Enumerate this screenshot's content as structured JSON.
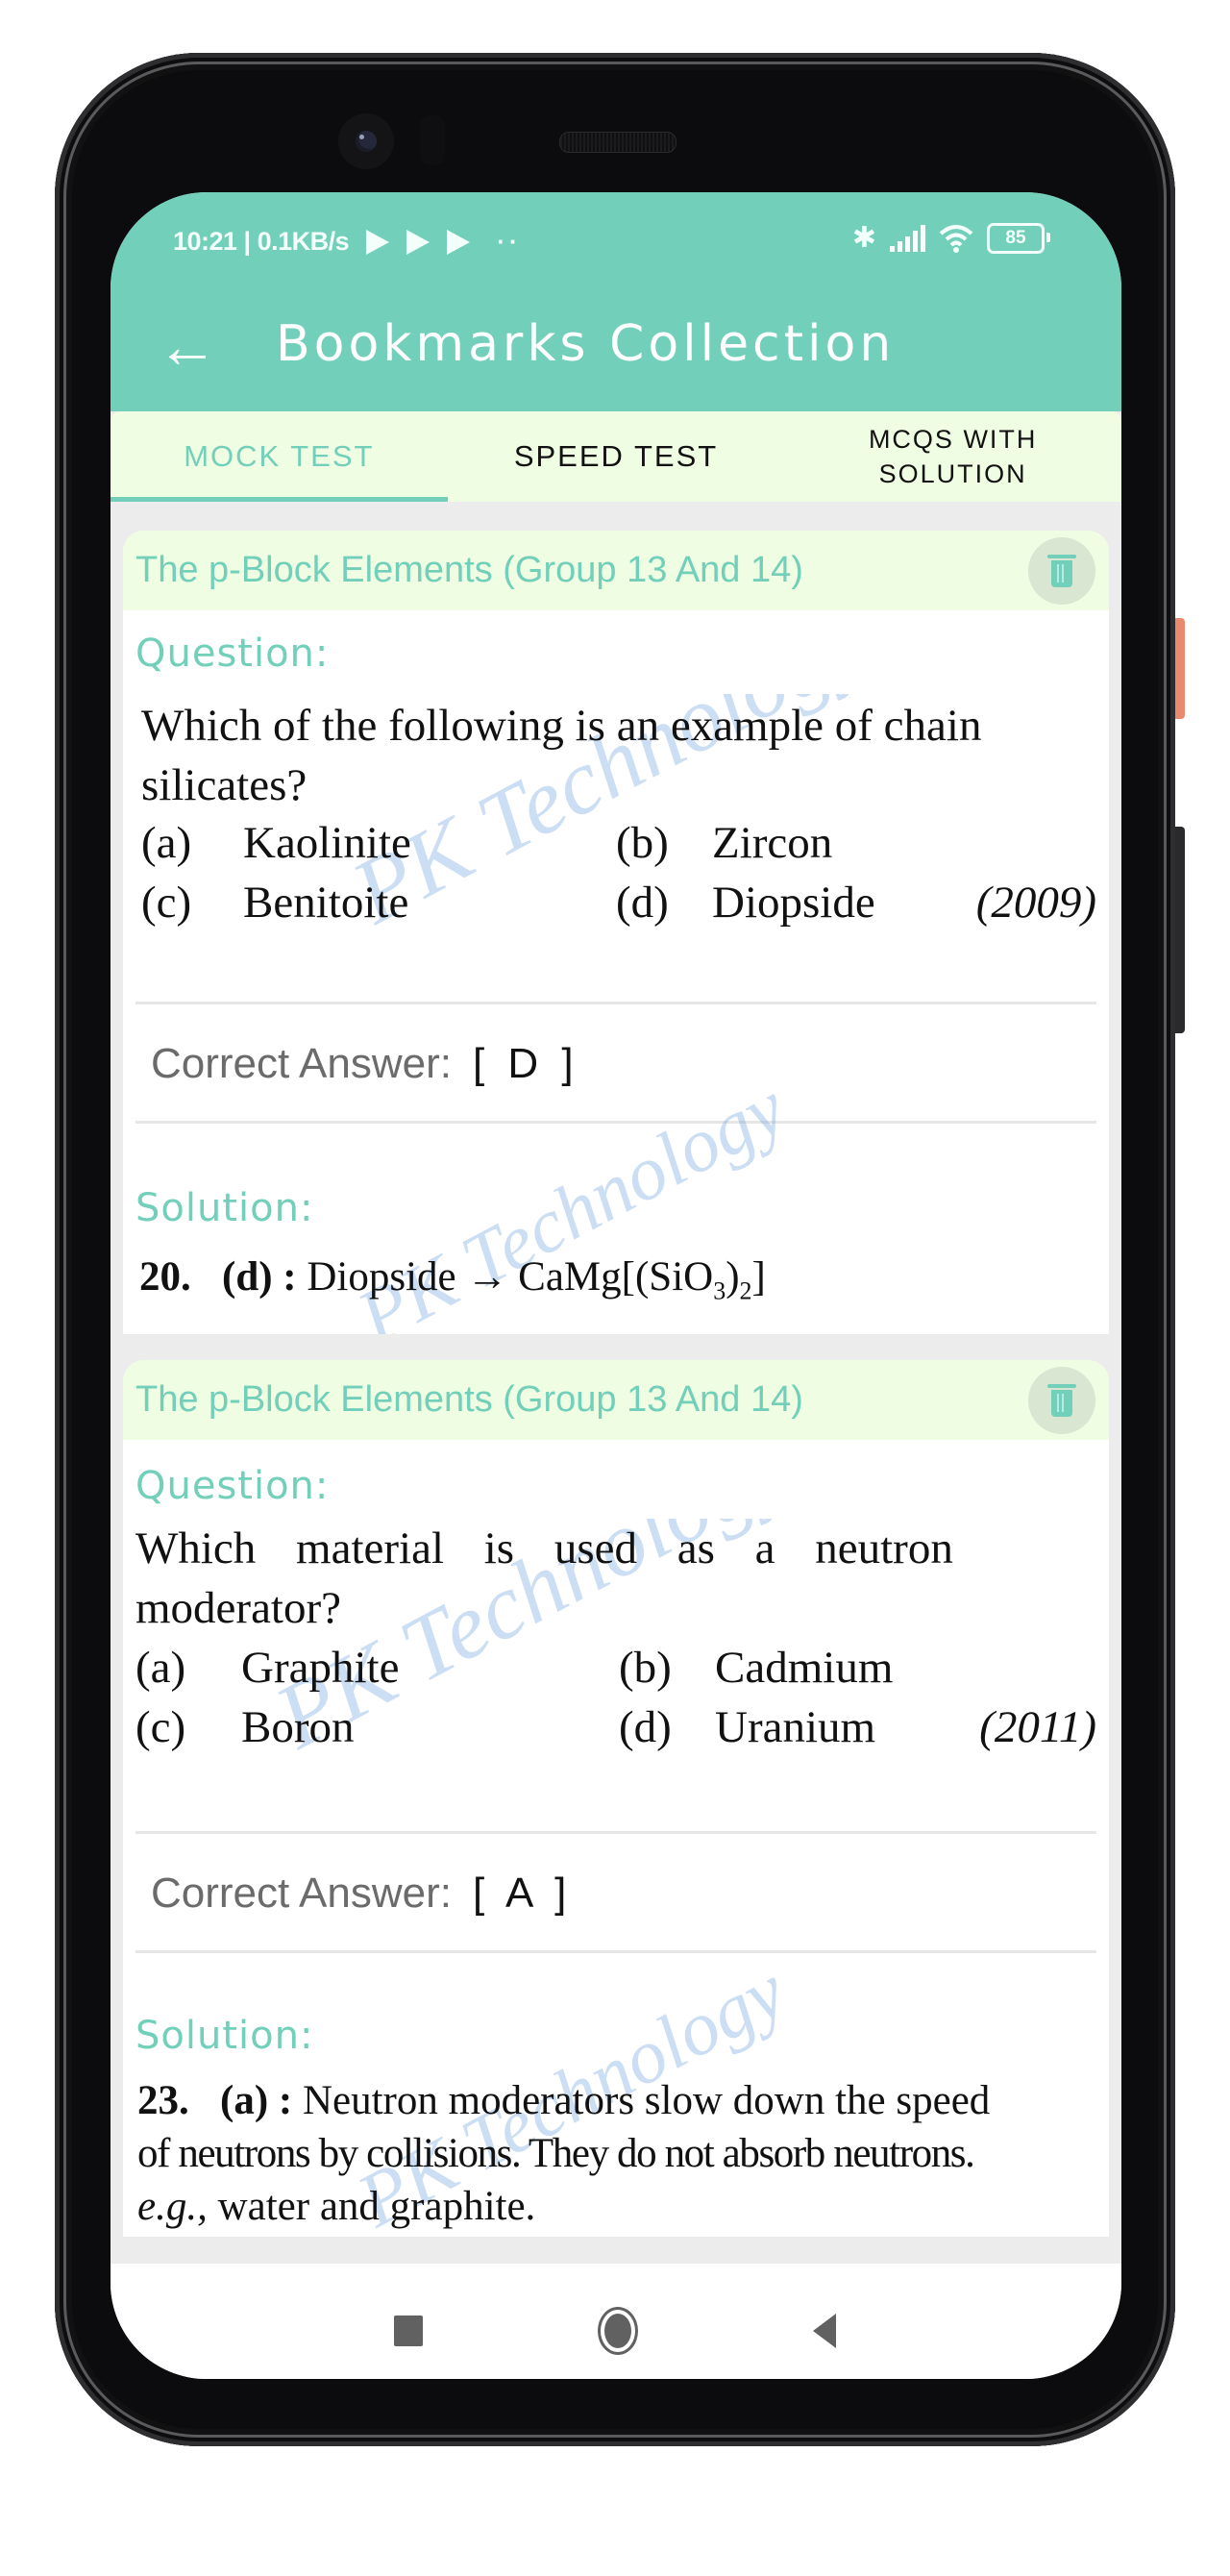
{
  "status_bar": {
    "time_speed": "10:21 | 0.1KB/s",
    "notification_icons": [
      "play-store-icon",
      "play-store-icon",
      "play-store-icon"
    ],
    "more_dots": "··",
    "bluetooth_icon": "bluetooth-icon",
    "signal_icon": "signal-icon",
    "wifi_icon": "wifi-icon",
    "battery_level": "85"
  },
  "header": {
    "back_icon": "←",
    "title": "Bookmarks Collection"
  },
  "tabs": [
    {
      "label": "MOCK TEST",
      "active": true
    },
    {
      "label": "SPEED TEST",
      "active": false
    },
    {
      "label_line1": "MCQS WITH",
      "label_line2": "SOLUTION",
      "active": false
    }
  ],
  "colors": {
    "accent": "#72cfba",
    "header_bg": "#72cfba",
    "tab_bg": "#effde2",
    "card_header_bg": "#effde2",
    "list_bg": "#ececec"
  },
  "labels": {
    "question": "Question:",
    "correct_answer": "Correct Answer:",
    "solution": "Solution:"
  },
  "bookmarks": [
    {
      "chapter": "The p-Block Elements (Group 13 And 14)",
      "question_lines": [
        "Which of the following is an example of chain",
        "silicates?"
      ],
      "options": [
        {
          "key": "(a)",
          "text": "Kaolinite"
        },
        {
          "key": "(b)",
          "text": "Zircon"
        },
        {
          "key": "(c)",
          "text": "Benitoite"
        },
        {
          "key": "(d)",
          "text": "Diopside"
        }
      ],
      "year": "(2009)",
      "correct_answer": "[ D ]",
      "solution": {
        "number": "20.",
        "key": "(d) :",
        "text": "Diopside → CaMg[(SiO",
        "sub1": "3",
        "mid": ")",
        "sub2": "2",
        "end": "]"
      },
      "watermark": "PK Technology"
    },
    {
      "chapter": "The p-Block Elements (Group 13 And 14)",
      "question_lines": [
        "Which material is used as a neutron",
        "moderator?"
      ],
      "options": [
        {
          "key": "(a)",
          "text": "Graphite"
        },
        {
          "key": "(b)",
          "text": "Cadmium"
        },
        {
          "key": "(c)",
          "text": "Boron"
        },
        {
          "key": "(d)",
          "text": "Uranium"
        }
      ],
      "year": "(2011)",
      "correct_answer": "[ A ]",
      "solution": {
        "number": "23.",
        "key": "(a) :",
        "line1": "Neutron moderators slow down the speed",
        "line2": "of neutrons by collisions. They do not absorb neutrons.",
        "line3_italic": "e.g.,",
        "line3": "water and graphite."
      },
      "watermark": "PK Technology"
    }
  ],
  "nav_bar": {
    "recent_icon": "recent-apps-icon",
    "home_icon": "home-icon",
    "back_icon": "back-triangle-icon"
  }
}
